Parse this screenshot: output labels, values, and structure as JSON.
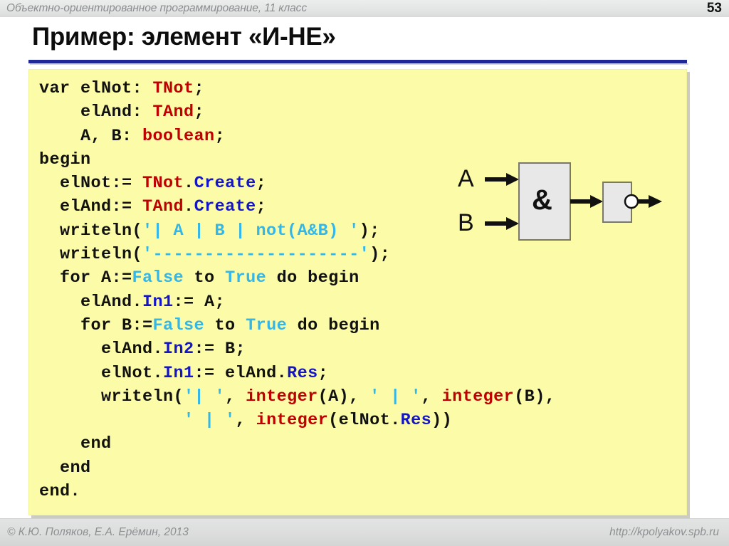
{
  "header": {
    "course_title": "Объектно-ориентированное программирование, 11 класс",
    "page_number": "53"
  },
  "slide": {
    "title": "Пример: элемент «И-НЕ»",
    "accent_color": "#202898",
    "code_background": "#fbfba8"
  },
  "code": {
    "language": "Pascal",
    "colors": {
      "type": "#c00000",
      "member": "#1515c8",
      "literal": "#33b6e8",
      "plain": "#111111"
    },
    "lines": [
      {
        "indent": 0,
        "tokens": [
          {
            "t": "var elNot: ",
            "c": "plain"
          },
          {
            "t": "TNot",
            "c": "type"
          },
          {
            "t": ";",
            "c": "plain"
          }
        ]
      },
      {
        "indent": 0,
        "tokens": [
          {
            "t": "    elAnd: ",
            "c": "plain"
          },
          {
            "t": "TAnd",
            "c": "type"
          },
          {
            "t": ";",
            "c": "plain"
          }
        ]
      },
      {
        "indent": 0,
        "tokens": [
          {
            "t": "    A, B: ",
            "c": "plain"
          },
          {
            "t": "boolean",
            "c": "type"
          },
          {
            "t": ";",
            "c": "plain"
          }
        ]
      },
      {
        "indent": 0,
        "tokens": [
          {
            "t": "begin",
            "c": "plain"
          }
        ]
      },
      {
        "indent": 0,
        "tokens": [
          {
            "t": "  elNot:= ",
            "c": "plain"
          },
          {
            "t": "TNot",
            "c": "type"
          },
          {
            "t": ".",
            "c": "plain"
          },
          {
            "t": "Create",
            "c": "member"
          },
          {
            "t": ";",
            "c": "plain"
          }
        ]
      },
      {
        "indent": 0,
        "tokens": [
          {
            "t": "  elAnd:= ",
            "c": "plain"
          },
          {
            "t": "TAnd",
            "c": "type"
          },
          {
            "t": ".",
            "c": "plain"
          },
          {
            "t": "Create",
            "c": "member"
          },
          {
            "t": ";",
            "c": "plain"
          }
        ]
      },
      {
        "indent": 0,
        "tokens": [
          {
            "t": "  writeln(",
            "c": "plain"
          },
          {
            "t": "'| A | B | not(A&B) '",
            "c": "literal"
          },
          {
            "t": ");",
            "c": "plain"
          }
        ]
      },
      {
        "indent": 0,
        "tokens": [
          {
            "t": "  writeln(",
            "c": "plain"
          },
          {
            "t": "'--------------------'",
            "c": "literal"
          },
          {
            "t": ");",
            "c": "plain"
          }
        ]
      },
      {
        "indent": 0,
        "tokens": [
          {
            "t": "  for A:=",
            "c": "plain"
          },
          {
            "t": "False",
            "c": "literal"
          },
          {
            "t": " to ",
            "c": "plain"
          },
          {
            "t": "True",
            "c": "literal"
          },
          {
            "t": " do begin",
            "c": "plain"
          }
        ]
      },
      {
        "indent": 0,
        "tokens": [
          {
            "t": "    elAnd.",
            "c": "plain"
          },
          {
            "t": "In1",
            "c": "member"
          },
          {
            "t": ":= A;",
            "c": "plain"
          }
        ]
      },
      {
        "indent": 0,
        "tokens": [
          {
            "t": "    for B:=",
            "c": "plain"
          },
          {
            "t": "False",
            "c": "literal"
          },
          {
            "t": " to ",
            "c": "plain"
          },
          {
            "t": "True",
            "c": "literal"
          },
          {
            "t": " do begin",
            "c": "plain"
          }
        ]
      },
      {
        "indent": 0,
        "tokens": [
          {
            "t": "      elAnd.",
            "c": "plain"
          },
          {
            "t": "In2",
            "c": "member"
          },
          {
            "t": ":= B;",
            "c": "plain"
          }
        ]
      },
      {
        "indent": 0,
        "tokens": [
          {
            "t": "      elNot.",
            "c": "plain"
          },
          {
            "t": "In1",
            "c": "member"
          },
          {
            "t": ":= elAnd.",
            "c": "plain"
          },
          {
            "t": "Res",
            "c": "member"
          },
          {
            "t": ";",
            "c": "plain"
          }
        ]
      },
      {
        "indent": 0,
        "tokens": [
          {
            "t": "      writeln(",
            "c": "plain"
          },
          {
            "t": "'| '",
            "c": "literal"
          },
          {
            "t": ", ",
            "c": "plain"
          },
          {
            "t": "integer",
            "c": "type"
          },
          {
            "t": "(A), ",
            "c": "plain"
          },
          {
            "t": "' | '",
            "c": "literal"
          },
          {
            "t": ", ",
            "c": "plain"
          },
          {
            "t": "integer",
            "c": "type"
          },
          {
            "t": "(B),",
            "c": "plain"
          }
        ]
      },
      {
        "indent": 0,
        "tokens": [
          {
            "t": "              ",
            "c": "plain"
          },
          {
            "t": "' | '",
            "c": "literal"
          },
          {
            "t": ", ",
            "c": "plain"
          },
          {
            "t": "integer",
            "c": "type"
          },
          {
            "t": "(elNot.",
            "c": "plain"
          },
          {
            "t": "Res",
            "c": "member"
          },
          {
            "t": "))",
            "c": "plain"
          }
        ]
      },
      {
        "indent": 0,
        "tokens": [
          {
            "t": "    end",
            "c": "plain"
          }
        ]
      },
      {
        "indent": 0,
        "tokens": [
          {
            "t": "  end",
            "c": "plain"
          }
        ]
      },
      {
        "indent": 0,
        "tokens": [
          {
            "t": "end.",
            "c": "plain"
          }
        ]
      }
    ]
  },
  "diagram": {
    "input_a_label": "A",
    "input_b_label": "B",
    "and_gate_label": "&",
    "not_gate_label": "",
    "gate_fill": "#e8e8e8",
    "gate_stroke": "#7a7a64"
  },
  "footer": {
    "copyright": "© К.Ю. Поляков, Е.А. Ерёмин, 2013",
    "url": "http://kpolyakov.spb.ru"
  }
}
